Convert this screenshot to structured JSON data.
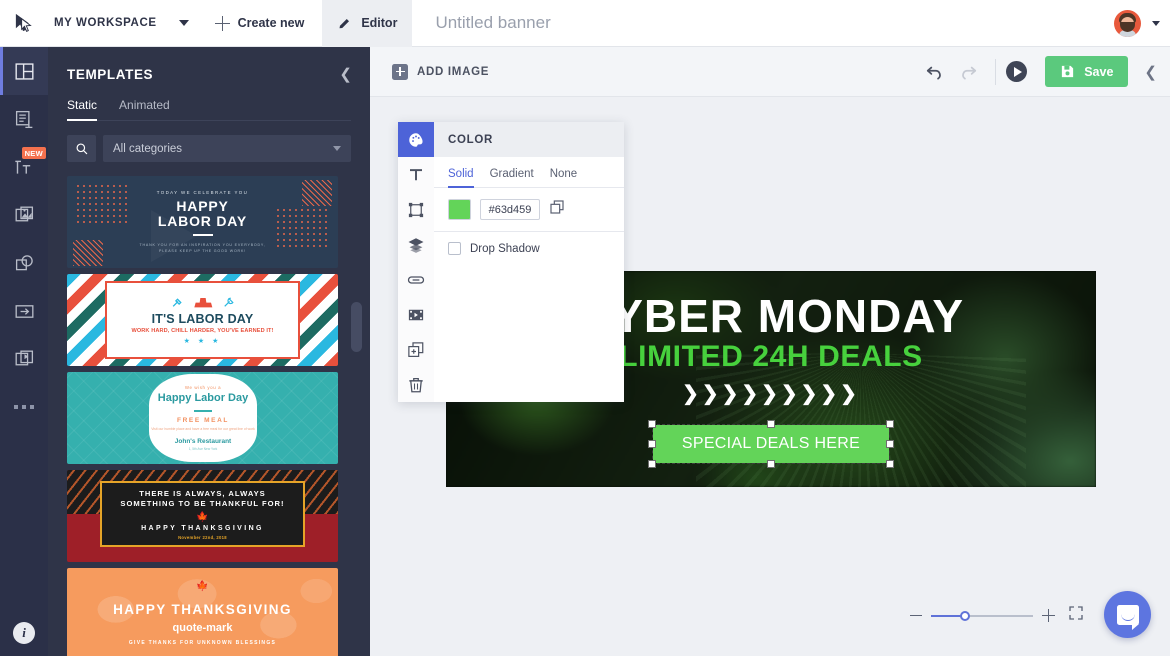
{
  "topbar": {
    "logo_icon": "cursor-logo-icon",
    "workspace": "MY WORKSPACE",
    "workspace_caret_icon": "chevron-down-icon",
    "create_new": "Create new",
    "create_new_icon": "plus-icon",
    "editor_tab": "Editor",
    "editor_icon": "pencil-icon",
    "document_title": "Untitled banner",
    "avatar_icon": "user-avatar",
    "account_caret_icon": "chevron-down-icon"
  },
  "rail": {
    "items": [
      {
        "name": "templates",
        "icon": "layout-panel-icon",
        "active": true,
        "badge": ""
      },
      {
        "name": "text-blocks",
        "icon": "document-text-icon",
        "active": false,
        "badge": ""
      },
      {
        "name": "text-tool",
        "icon": "text-tool-icon",
        "active": false,
        "badge": "NEW"
      },
      {
        "name": "images",
        "icon": "images-stack-icon",
        "active": false,
        "badge": ""
      },
      {
        "name": "shapes",
        "icon": "shapes-icon",
        "active": false,
        "badge": ""
      },
      {
        "name": "cta-button",
        "icon": "arrow-in-box-icon",
        "active": false,
        "badge": ""
      },
      {
        "name": "video",
        "icon": "video-stack-icon",
        "active": false,
        "badge": ""
      },
      {
        "name": "more",
        "icon": "ellipsis-icon",
        "active": false,
        "badge": ""
      }
    ],
    "info_label": "i",
    "info_icon": "info-icon"
  },
  "templates_panel": {
    "title": "TEMPLATES",
    "collapse_icon": "chevron-left-icon",
    "tabs": [
      {
        "label": "Static",
        "active": true
      },
      {
        "label": "Animated",
        "active": false
      }
    ],
    "search_icon": "search-icon",
    "category_value": "All categories",
    "category_caret_icon": "chevron-down-icon",
    "items": [
      {
        "name": "happy-labor-day-navy",
        "eyebrow": "TODAY WE CELEBRATE YOU",
        "title_line1": "HAPPY",
        "title_line2": "LABOR DAY",
        "subtext": "THANK YOU FOR AN INSPIRATION YOU EVERYBODY, PLEASE KEEP UP THE GOOD WORK!"
      },
      {
        "name": "its-labor-day-stripes",
        "title": "IT'S LABOR DAY",
        "subtitle": "WORK HARD, CHILL HARDER, YOU'VE EARNED IT!",
        "stars": "★ ★ ★"
      },
      {
        "name": "happy-labor-day-teal",
        "eyebrow": "We wish you a",
        "title": "Happy Labor Day",
        "offer": "FREE MEAL",
        "description": "Visit our humble place and have a free meal for our great line of work",
        "restaurant": "John's Restaurant",
        "address": "1, 5th Ave New York"
      },
      {
        "name": "thankful-for-thanksgiving",
        "title_line1": "THERE IS ALWAYS, ALWAYS",
        "title_line2": "SOMETHING TO BE THANKFUL FOR!",
        "leaf_icon": "maple-leaf-icon",
        "greeting": "HAPPY THANKSGIVING",
        "date": "November 22nd, 2018"
      },
      {
        "name": "happy-thanksgiving-orange",
        "leaf_icon": "maple-leaf-icon",
        "title": "HAPPY THANKSGIVING",
        "quote_icon": "quote-mark",
        "subtitle": "GIVE THANKS FOR UNKNOWN BLESSINGS"
      }
    ]
  },
  "editor_toolbar": {
    "add_image": "ADD IMAGE",
    "add_image_icon": "plus-square-icon",
    "undo_icon": "undo-arrow-icon",
    "redo_icon": "redo-arrow-icon",
    "preview_icon": "play-circle-icon",
    "save_label": "Save",
    "save_icon": "floppy-disk-icon",
    "collapse_icon": "chevron-left-icon"
  },
  "property_panel": {
    "title": "COLOR",
    "rail_icons": [
      {
        "name": "color-palette",
        "icon": "palette-icon",
        "active": true
      },
      {
        "name": "text",
        "icon": "text-T-icon",
        "active": false
      },
      {
        "name": "transform",
        "icon": "transform-handles-icon",
        "active": false
      },
      {
        "name": "layers",
        "icon": "layers-icon",
        "active": false
      },
      {
        "name": "link",
        "icon": "link-icon",
        "active": false
      },
      {
        "name": "animation",
        "icon": "film-strip-icon",
        "active": false
      },
      {
        "name": "duplicate",
        "icon": "duplicate-plus-icon",
        "active": false
      },
      {
        "name": "delete",
        "icon": "trash-icon",
        "active": false
      }
    ],
    "tabs": [
      {
        "label": "Solid",
        "active": true
      },
      {
        "label": "Gradient",
        "active": false
      },
      {
        "label": "None",
        "active": false
      }
    ],
    "hex_value": "#63d459",
    "swatch_color": "#63d459",
    "copy_icon": "copy-icon",
    "drop_shadow_label": "Drop Shadow",
    "drop_shadow_checked": false
  },
  "banner": {
    "headline": "CYBER MONDAY",
    "subhead": "LIMITED 24H DEALS",
    "chevrons": "❯❯❯❯❯❯❯❯❯",
    "cta_text": "SPECIAL DEALS HERE",
    "cta_color": "#63d459",
    "subhead_color": "#47d13d",
    "selected": true
  },
  "zoom_controls": {
    "minus_icon": "minus-icon",
    "plus_icon": "plus-icon",
    "fit_icon": "fit-to-screen-icon",
    "value": 30
  },
  "chat": {
    "icon": "chat-bubble-icon"
  }
}
